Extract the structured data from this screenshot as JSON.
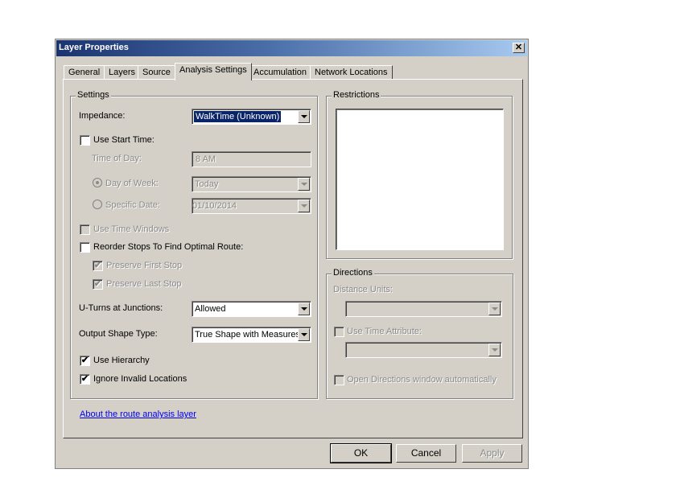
{
  "window": {
    "title": "Layer Properties",
    "close_icon": "close-icon"
  },
  "tabs": [
    {
      "label": "General"
    },
    {
      "label": "Layers"
    },
    {
      "label": "Source"
    },
    {
      "label": "Analysis Settings",
      "active": true
    },
    {
      "label": "Accumulation"
    },
    {
      "label": "Network Locations"
    }
  ],
  "settings": {
    "legend": "Settings",
    "impedance": {
      "label": "Impedance:",
      "value": "WalkTime (Unknown)"
    },
    "use_start_time": {
      "label": "Use Start Time:",
      "checked": false
    },
    "time_of_day": {
      "label": "Time of Day:",
      "value": "8 AM"
    },
    "day_of_week": {
      "label": "Day of Week:",
      "value": "Today",
      "selected": true
    },
    "specific_date": {
      "label": "Specific Date:",
      "value": "01/10/2014",
      "selected": false
    },
    "use_time_windows": {
      "label": "Use Time Windows",
      "checked": false
    },
    "reorder_stops": {
      "label": "Reorder Stops To Find Optimal Route:",
      "checked": false
    },
    "preserve_first": {
      "label": "Preserve First Stop",
      "checked": true
    },
    "preserve_last": {
      "label": "Preserve Last Stop",
      "checked": true
    },
    "uturns": {
      "label": "U-Turns at Junctions:",
      "value": "Allowed"
    },
    "output_shape": {
      "label": "Output Shape Type:",
      "value": "True Shape with Measures"
    },
    "use_hierarchy": {
      "label": "Use Hierarchy",
      "checked": true
    },
    "ignore_invalid": {
      "label": "Ignore Invalid Locations",
      "checked": true
    }
  },
  "restrictions": {
    "legend": "Restrictions",
    "items": []
  },
  "directions": {
    "legend": "Directions",
    "distance_units": {
      "label": "Distance Units:",
      "value": ""
    },
    "use_time_attribute": {
      "label": "Use Time Attribute:",
      "checked": false,
      "value": ""
    },
    "open_window": {
      "label": "Open Directions window automatically",
      "checked": false
    }
  },
  "about_link": "About the route analysis layer",
  "buttons": {
    "ok": "OK",
    "cancel": "Cancel",
    "apply": "Apply"
  },
  "check_glyph": "✔"
}
